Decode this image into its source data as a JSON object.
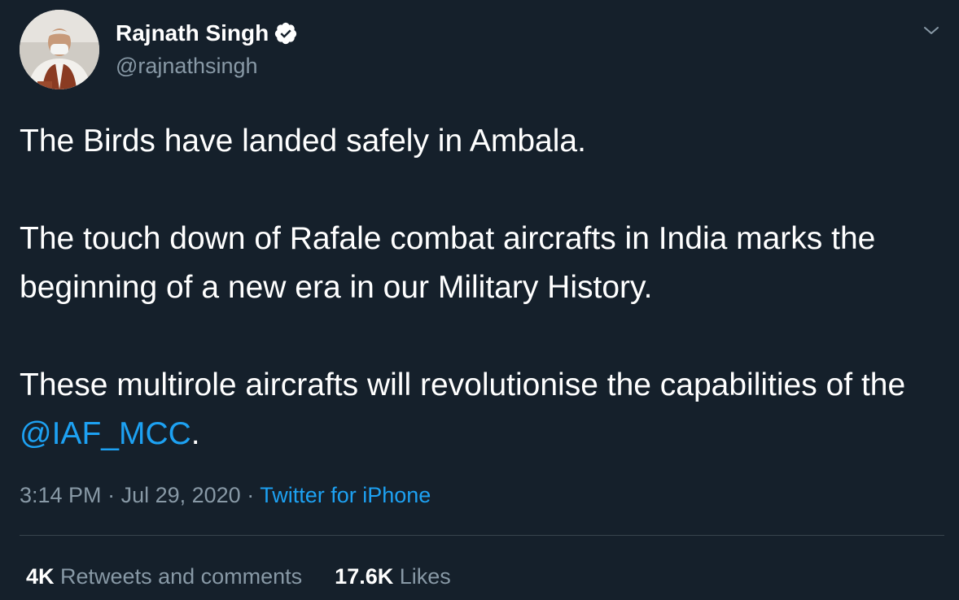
{
  "author": {
    "display_name": "Rajnath Singh",
    "handle": "@rajnathsingh",
    "verified": true
  },
  "tweet": {
    "paragraph_1": "The Birds have landed safely in Ambala.",
    "paragraph_2": "The touch down of Rafale combat aircrafts in India marks the beginning of a new era in our Military History.",
    "paragraph_3_before": "These multirole aircrafts will revolutionise the capabilities of the ",
    "mention": "@IAF_MCC",
    "paragraph_3_after": "."
  },
  "meta": {
    "time": "3:14 PM",
    "separator_1": " · ",
    "date": "Jul 29, 2020",
    "separator_2": " · ",
    "source": "Twitter for iPhone"
  },
  "stats": {
    "retweets_count": "4K",
    "retweets_label": "Retweets and comments",
    "likes_count": "17.6K",
    "likes_label": "Likes"
  },
  "icons": {
    "verified": "verified-badge-icon",
    "more": "chevron-down-icon"
  },
  "colors": {
    "background": "#15202b",
    "text": "#ffffff",
    "secondary": "#8899a6",
    "accent": "#1da1f2",
    "divider": "#38444d"
  }
}
